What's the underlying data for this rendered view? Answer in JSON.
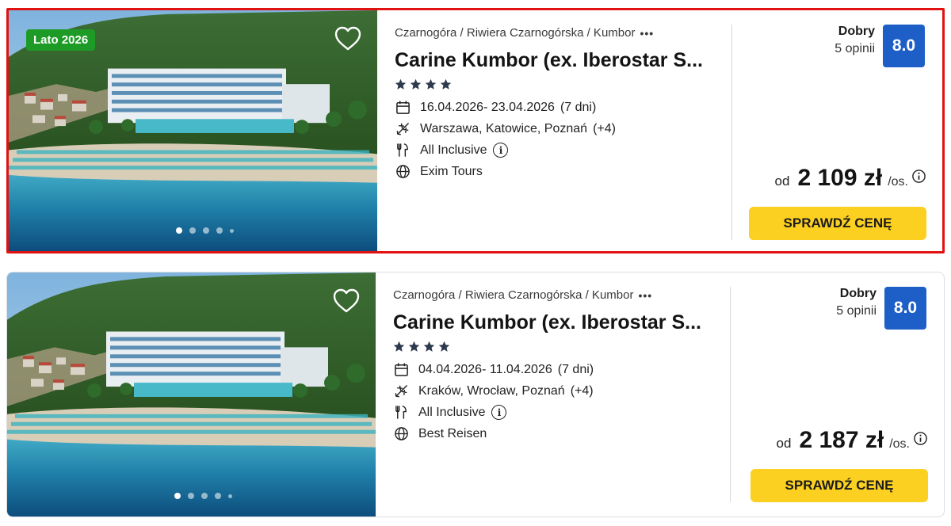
{
  "offers": [
    {
      "season_badge": "Lato 2026",
      "location": "Czarnogóra / Riwiera Czarnogórska / Kumbor",
      "more": "•••",
      "hotel_name": "Carine Kumbor (ex. Iberostar S...",
      "stars": 4,
      "dates": "16.04.2026- 23.04.2026",
      "duration": "(7 dni)",
      "departure": "Warszawa, Katowice, Poznań",
      "departure_extra": "(+4)",
      "board": "All Inclusive",
      "operator": "Exim Tours",
      "rating_label": "Dobry",
      "reviews": "5 opinii",
      "score": "8.0",
      "price_from": "od",
      "price": "2 109 zł",
      "price_unit": "/os.",
      "cta_label": "SPRAWDŹ CENĘ",
      "gallery_active": 1,
      "gallery_count": 5
    },
    {
      "location": "Czarnogóra / Riwiera Czarnogórska / Kumbor",
      "more": "•••",
      "hotel_name": "Carine Kumbor (ex. Iberostar S...",
      "stars": 4,
      "dates": "04.04.2026- 11.04.2026",
      "duration": "(7 dni)",
      "departure": "Kraków, Wrocław, Poznań",
      "departure_extra": "(+4)",
      "board": "All Inclusive",
      "operator": "Best Reisen",
      "rating_label": "Dobry",
      "reviews": "5 opinii",
      "score": "8.0",
      "price_from": "od",
      "price": "2 187 zł",
      "price_unit": "/os.",
      "cta_label": "SPRAWDŹ CENĘ",
      "gallery_active": 1,
      "gallery_count": 5
    }
  ],
  "icons": {
    "favorite": "heart-outline-icon",
    "dates": "calendar-icon",
    "departure": "plane-icon",
    "board": "cutlery-icon",
    "operator": "globe-icon",
    "info": "info-circle-icon",
    "star": "star-icon"
  },
  "colors": {
    "season_badge": "#1e9b27",
    "score_badge": "#1d5fc7",
    "cta": "#fcd021",
    "highlight_border": "#e11212"
  }
}
